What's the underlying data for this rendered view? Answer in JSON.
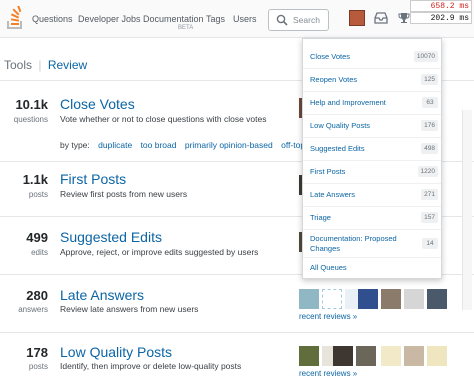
{
  "topbar": {
    "nav": [
      "Questions",
      "Developer Jobs",
      "Documentation",
      "Tags",
      "Users"
    ],
    "beta": "BETA",
    "search_placeholder": "Search",
    "perf_red": "658.2 ms",
    "perf_black": "202.9 ms"
  },
  "tabs": {
    "tools": "Tools",
    "separator": "|",
    "review": "Review"
  },
  "queues": [
    {
      "count": "10.1k",
      "unit": "questions",
      "title": "Close Votes",
      "desc": "Vote whether or not to close questions with close votes"
    },
    {
      "count": "1.1k",
      "unit": "posts",
      "title": "First Posts",
      "desc": "Review first posts from new users"
    },
    {
      "count": "499",
      "unit": "edits",
      "title": "Suggested Edits",
      "desc": "Approve, reject, or improve edits suggested by users"
    },
    {
      "count": "280",
      "unit": "answers",
      "title": "Late Answers",
      "desc": "Review late answers from new users"
    },
    {
      "count": "178",
      "unit": "posts",
      "title": "Low Quality Posts",
      "desc": "Identify, then improve or delete low-quality posts"
    }
  ],
  "bytype": {
    "label": "by type:",
    "links": [
      "duplicate",
      "too broad",
      "primarily opinion-based",
      "off-top"
    ]
  },
  "recent_reviews": "recent reviews »",
  "dropdown": [
    {
      "label": "Close Votes",
      "count": "10070"
    },
    {
      "label": "Reopen Votes",
      "count": "125"
    },
    {
      "label": "Help and Improvement",
      "count": "63"
    },
    {
      "label": "Low Quality Posts",
      "count": "176"
    },
    {
      "label": "Suggested Edits",
      "count": "498"
    },
    {
      "label": "First Posts",
      "count": "1220"
    },
    {
      "label": "Late Answers",
      "count": "271"
    },
    {
      "label": "Triage",
      "count": "157"
    },
    {
      "label": "Documentation: Proposed Changes",
      "count": "14"
    },
    {
      "label": "All Queues",
      "count": ""
    }
  ],
  "colors": {
    "link": "#0c65a5",
    "logo_orange": "#f48024",
    "perf_red": "#d21c1c"
  },
  "icons": [
    "stack-overflow-logo",
    "search-icon",
    "user-avatar",
    "inbox-icon",
    "achievements-trophy-icon",
    "review-queue-icon",
    "help-icon"
  ]
}
